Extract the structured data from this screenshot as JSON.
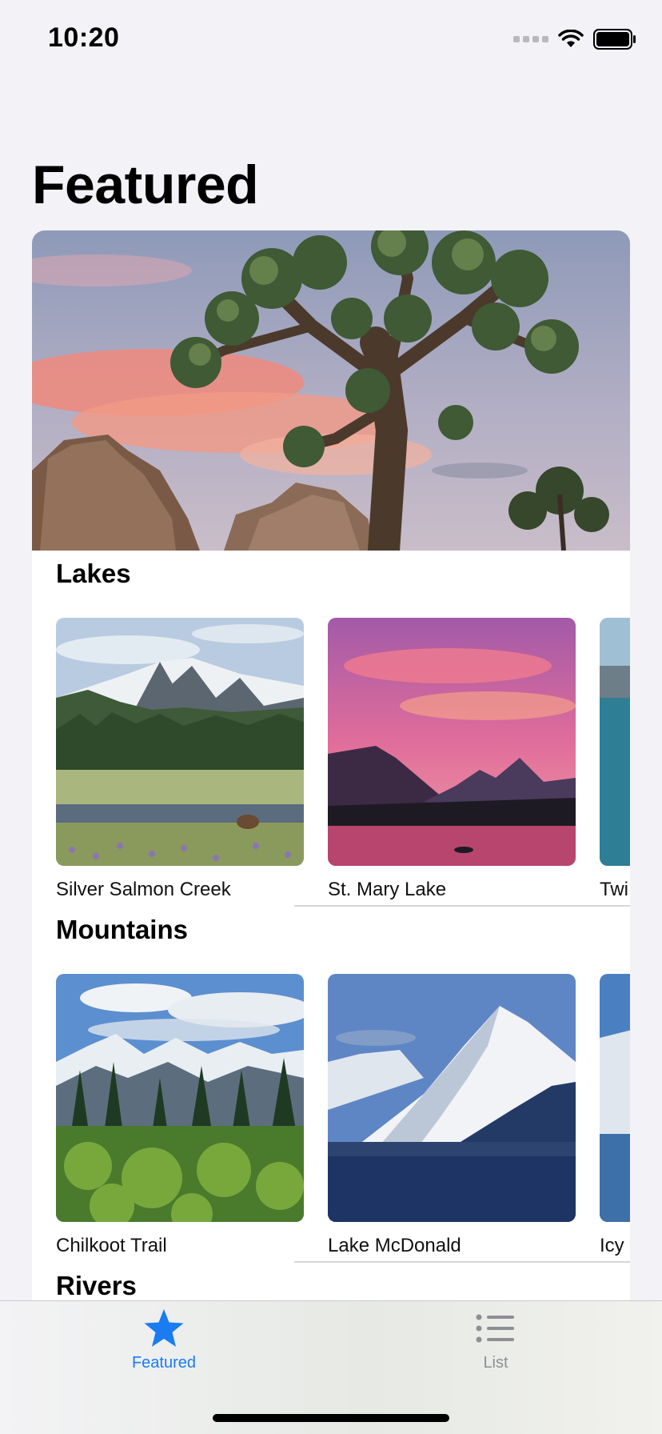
{
  "status_bar": {
    "time": "10:20"
  },
  "page": {
    "title": "Featured"
  },
  "sections": [
    {
      "title": "Lakes",
      "items": [
        {
          "name": "Silver Salmon Creek"
        },
        {
          "name": "St. Mary Lake"
        },
        {
          "name": "Twi"
        }
      ]
    },
    {
      "title": "Mountains",
      "items": [
        {
          "name": "Chilkoot Trail"
        },
        {
          "name": "Lake McDonald"
        },
        {
          "name": "Icy"
        }
      ]
    },
    {
      "title": "Rivers"
    }
  ],
  "tabbar": {
    "tabs": [
      {
        "label": "Featured",
        "icon": "star-icon",
        "selected": true
      },
      {
        "label": "List",
        "icon": "list-icon",
        "selected": false
      }
    ]
  },
  "colors": {
    "accent": "#1a7cf0",
    "inactive": "#8e8e93",
    "background": "#f2f2f7"
  }
}
